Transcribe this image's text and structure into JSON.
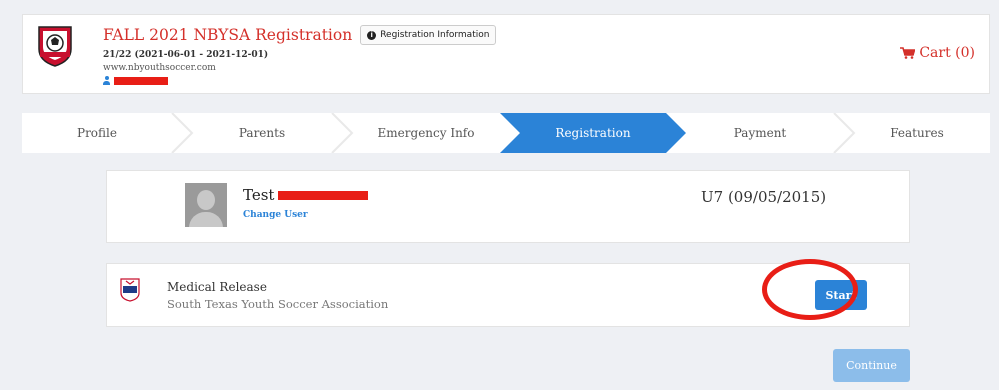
{
  "header": {
    "title": "FALL 2021 NBYSA Registration",
    "info_button": "Registration Information",
    "dates": "21/22 (2021-06-01 - 2021-12-01)",
    "website": "www.nbyouthsoccer.com",
    "cart": "Cart (0)"
  },
  "steps": [
    "Profile",
    "Parents",
    "Emergency Info",
    "Registration",
    "Payment",
    "Features"
  ],
  "active_step": "Registration",
  "player": {
    "first_name": "Test",
    "change_user": "Change User",
    "age_group": "U7 (09/05/2015)"
  },
  "form": {
    "name": "Medical Release",
    "organization": "South Texas Youth Soccer Association",
    "start_label": "Start",
    "badge_text": "SOUTH TEXAS"
  },
  "continue_label": "Continue",
  "colors": {
    "accent": "#2b83d7",
    "brand_red": "#d4302a",
    "annotation_red": "#e81e16"
  }
}
